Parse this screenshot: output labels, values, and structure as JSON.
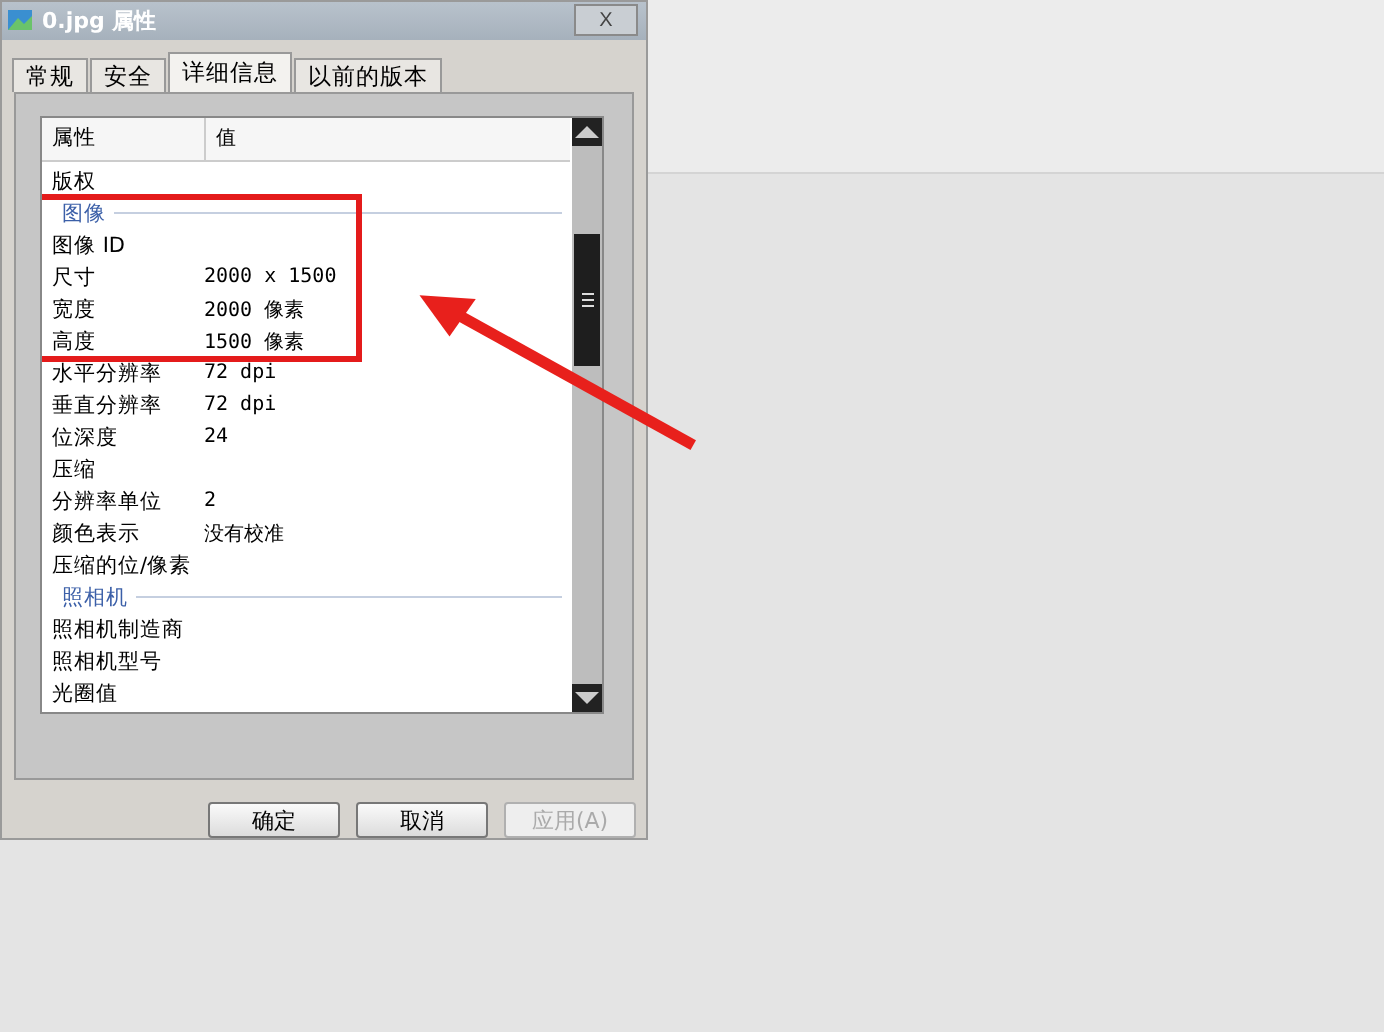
{
  "window": {
    "title": "0.jpg 属性",
    "close": "X"
  },
  "tabs": [
    {
      "label": "常规",
      "selected": false
    },
    {
      "label": "安全",
      "selected": false
    },
    {
      "label": "详细信息",
      "selected": true
    },
    {
      "label": "以前的版本",
      "selected": false
    }
  ],
  "table": {
    "columns": [
      "属性",
      "值"
    ],
    "rows": [
      {
        "kind": "property",
        "name": "版权",
        "value": ""
      },
      {
        "kind": "group",
        "name": "图像"
      },
      {
        "kind": "property",
        "name": "图像 ID",
        "value": ""
      },
      {
        "kind": "property",
        "name": "尺寸",
        "value": "2000 x 1500"
      },
      {
        "kind": "property",
        "name": "宽度",
        "value": "2000 像素"
      },
      {
        "kind": "property",
        "name": "高度",
        "value": "1500 像素"
      },
      {
        "kind": "property",
        "name": "水平分辨率",
        "value": "72 dpi"
      },
      {
        "kind": "property",
        "name": "垂直分辨率",
        "value": "72 dpi"
      },
      {
        "kind": "property",
        "name": "位深度",
        "value": "24"
      },
      {
        "kind": "property",
        "name": "压缩",
        "value": ""
      },
      {
        "kind": "property",
        "name": "分辨率单位",
        "value": "2"
      },
      {
        "kind": "property",
        "name": "颜色表示",
        "value": "没有校准"
      },
      {
        "kind": "property",
        "name": "压缩的位/像素",
        "value": ""
      },
      {
        "kind": "group",
        "name": "照相机"
      },
      {
        "kind": "property",
        "name": "照相机制造商",
        "value": ""
      },
      {
        "kind": "property",
        "name": "照相机型号",
        "value": ""
      },
      {
        "kind": "property",
        "name": "光圈值",
        "value": ""
      }
    ]
  },
  "buttons": [
    {
      "label": "确定",
      "disabled": false
    },
    {
      "label": "取消",
      "disabled": false
    },
    {
      "label": "应用(A)",
      "disabled": true
    }
  ]
}
